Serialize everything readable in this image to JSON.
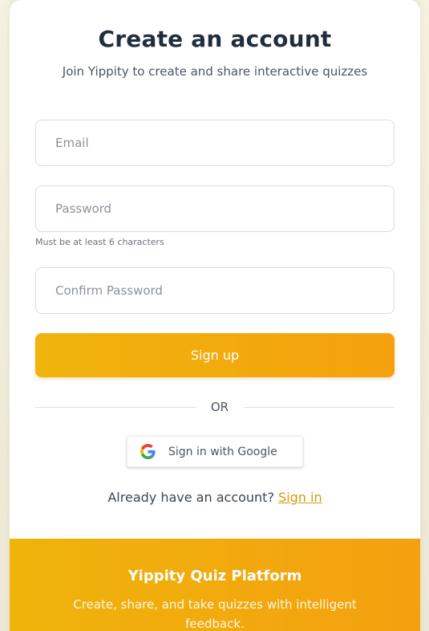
{
  "header": {
    "title": "Create an account",
    "subtitle": "Join Yippity to create and share interactive quizzes"
  },
  "form": {
    "email_placeholder": "Email",
    "password_placeholder": "Password",
    "password_hint": "Must be at least 6 characters",
    "confirm_placeholder": "Confirm Password",
    "submit_label": "Sign up"
  },
  "divider": {
    "label": "OR"
  },
  "google": {
    "label": "Sign in with Google",
    "icon": "google-g-icon"
  },
  "signin": {
    "prompt": "Already have an account?",
    "link_label": "Sign in"
  },
  "footer": {
    "title": "Yippity Quiz Platform",
    "description": "Create, share, and take quizzes with intelligent feedback."
  },
  "colors": {
    "accent_start": "#efb40b",
    "accent_end": "#f4a00f",
    "link": "#d89a0c"
  }
}
